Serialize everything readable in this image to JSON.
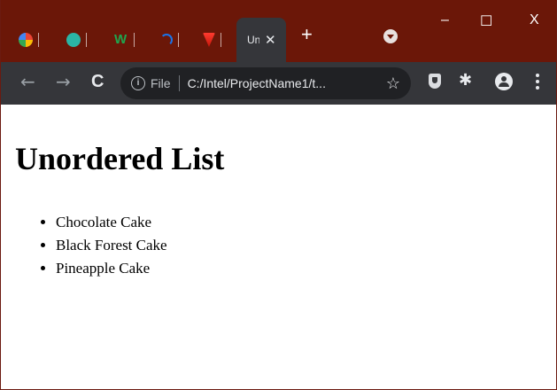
{
  "browser": {
    "tabs": [
      {
        "name": "google",
        "color": "#ea4335"
      },
      {
        "name": "shield",
        "color": "#2bb5a5"
      },
      {
        "name": "w-site",
        "color": "#188038"
      },
      {
        "name": "arc-site",
        "color": "#1a73e8"
      },
      {
        "name": "v-site",
        "color": "#ea4335"
      }
    ],
    "active_tab": {
      "title": "Unordered List"
    },
    "toolbar": {
      "back": "←",
      "forward": "→",
      "reload": "C",
      "info": "i",
      "scheme": "File",
      "url": "C:/Intel/ProjectName1/t...",
      "star": "☆"
    },
    "window_controls": {
      "minimize": "–",
      "maximize": "☐",
      "close": "X"
    }
  },
  "page": {
    "heading": "Unordered List",
    "items": [
      "Chocolate Cake",
      "Black Forest Cake",
      "Pineapple Cake"
    ]
  },
  "colors": {
    "frame": "#6b1708",
    "toolbar": "#35363a",
    "omnibox": "#202124"
  }
}
